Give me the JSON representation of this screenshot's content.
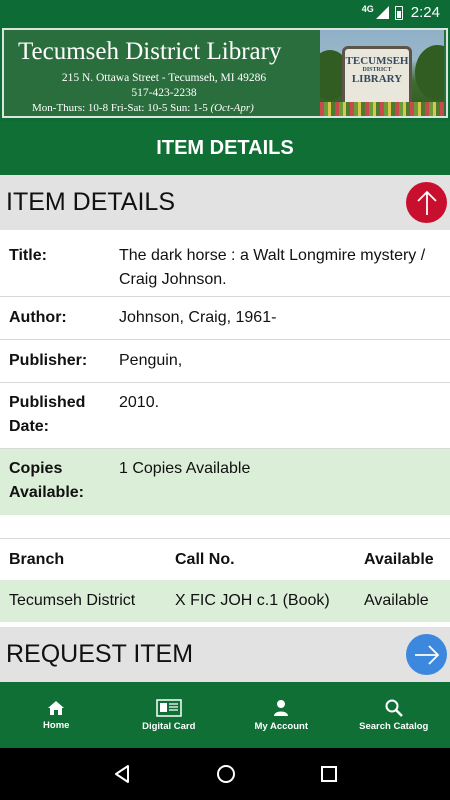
{
  "status_bar": {
    "network": "4G",
    "time": "2:24"
  },
  "banner": {
    "library_name": "Tecumseh District Library",
    "address": "215 N. Ottawa Street - Tecumseh, MI 49286",
    "phone": "517-423-2238",
    "hours_main": "Mon-Thurs: 10-8    Fri-Sat: 10-5    Sun: 1-5 ",
    "hours_note": "(Oct-Apr)",
    "sign": {
      "line1": "TECUMSEH",
      "line2": "DISTRICT",
      "line3": "LIBRARY"
    }
  },
  "title_bar": {
    "label": "ITEM DETAILS"
  },
  "details_section": {
    "heading": "ITEM DETAILS",
    "rows": [
      {
        "label": "Title:",
        "value": "The dark horse : a Walt Longmire mystery / Craig Johnson."
      },
      {
        "label": "Author:",
        "value": "Johnson, Craig, 1961-"
      },
      {
        "label": "Publisher:",
        "value": "Penguin,"
      },
      {
        "label": "Published Date:",
        "value": "2010."
      },
      {
        "label": "Copies Available:",
        "value": "1 Copies Available"
      }
    ]
  },
  "copies_table": {
    "headers": [
      "Branch",
      "Call No.",
      "Available"
    ],
    "rows": [
      [
        "Tecumseh District",
        "X FIC JOH c.1 (Book)",
        "Available"
      ]
    ]
  },
  "request_section": {
    "heading": "REQUEST ITEM"
  },
  "bottom_nav": {
    "items": [
      {
        "label": "Home",
        "icon": "home-icon"
      },
      {
        "label": "Digital Card",
        "icon": "card-icon"
      },
      {
        "label": "My Account",
        "icon": "person-icon"
      },
      {
        "label": "Search Catalog",
        "icon": "search-icon"
      }
    ]
  },
  "colors": {
    "brand_green": "#0f6f35",
    "accent_red": "#c8102e",
    "accent_blue": "#3c88de",
    "highlight_green": "#dbeed7"
  }
}
